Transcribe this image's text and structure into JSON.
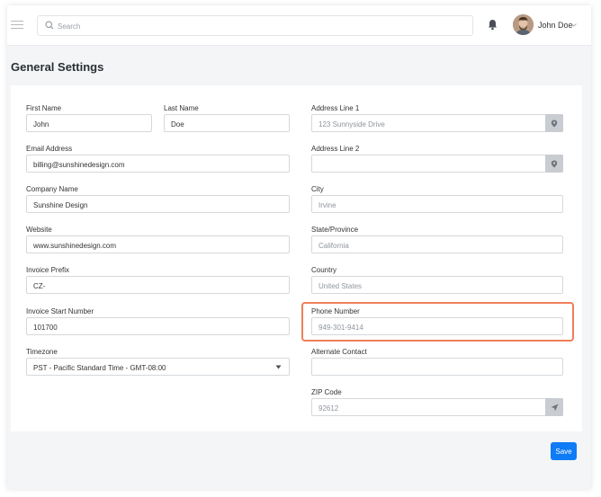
{
  "header": {
    "search_placeholder": "Search",
    "user_name": "John Doe"
  },
  "page": {
    "title": "General Settings"
  },
  "form": {
    "first_name": {
      "label": "First Name",
      "value": "John"
    },
    "last_name": {
      "label": "Last Name",
      "value": "Doe"
    },
    "email": {
      "label": "Email Address",
      "value": "billing@sunshinedesign.com"
    },
    "company": {
      "label": "Company Name",
      "value": "Sunshine Design"
    },
    "website": {
      "label": "Website",
      "value": "www.sunshinedesign.com"
    },
    "invoice_prefix": {
      "label": "Invoice Prefix",
      "value": "CZ-"
    },
    "invoice_start": {
      "label": "Invoice Start Number",
      "value": "101700"
    },
    "timezone": {
      "label": "Timezone",
      "value": "PST - Pacific Standard Time - GMT-08:00"
    },
    "address1": {
      "label": "Address Line 1",
      "placeholder": "123 Sunnyside Drive"
    },
    "address2": {
      "label": "Address Line 2",
      "placeholder": ""
    },
    "city": {
      "label": "City",
      "placeholder": "Irvine"
    },
    "state": {
      "label": "State/Province",
      "placeholder": "California"
    },
    "country": {
      "label": "Country",
      "placeholder": "United States"
    },
    "phone": {
      "label": "Phone Number",
      "placeholder": "949-301-9414"
    },
    "alt_contact": {
      "label": "Alternate Contact",
      "placeholder": ""
    },
    "zip": {
      "label": "ZIP Code",
      "placeholder": "92612"
    }
  },
  "actions": {
    "save_label": "Save"
  },
  "colors": {
    "primary": "#0e7cf6",
    "highlight": "#f07e5a"
  }
}
